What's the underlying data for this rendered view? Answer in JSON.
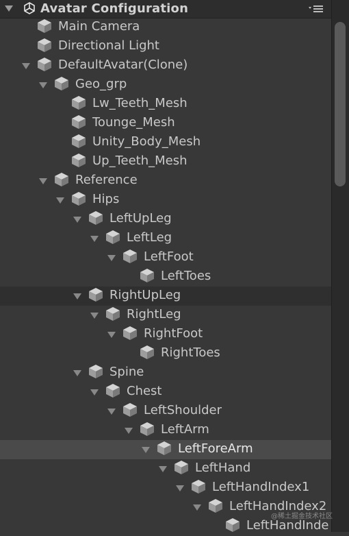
{
  "header": {
    "title": "Avatar Configuration",
    "logo_icon": "unity-logo-icon",
    "menu_icon": "dropdown-menu-icon"
  },
  "rows": [
    {
      "label": "Main Camera",
      "depth": 0,
      "expandable": false
    },
    {
      "label": "Directional Light",
      "depth": 0,
      "expandable": false
    },
    {
      "label": "DefaultAvatar(Clone)",
      "depth": 0,
      "expandable": true
    },
    {
      "label": "Geo_grp",
      "depth": 1,
      "expandable": true
    },
    {
      "label": "Lw_Teeth_Mesh",
      "depth": 2,
      "expandable": false
    },
    {
      "label": "Tounge_Mesh",
      "depth": 2,
      "expandable": false
    },
    {
      "label": "Unity_Body_Mesh",
      "depth": 2,
      "expandable": false
    },
    {
      "label": "Up_Teeth_Mesh",
      "depth": 2,
      "expandable": false
    },
    {
      "label": "Reference",
      "depth": 1,
      "expandable": true
    },
    {
      "label": "Hips",
      "depth": 2,
      "expandable": true
    },
    {
      "label": "LeftUpLeg",
      "depth": 3,
      "expandable": true
    },
    {
      "label": "LeftLeg",
      "depth": 4,
      "expandable": true
    },
    {
      "label": "LeftFoot",
      "depth": 5,
      "expandable": true
    },
    {
      "label": "LeftToes",
      "depth": 6,
      "expandable": false
    },
    {
      "label": "RightUpLeg",
      "depth": 3,
      "expandable": true,
      "state": "hover"
    },
    {
      "label": "RightLeg",
      "depth": 4,
      "expandable": true
    },
    {
      "label": "RightFoot",
      "depth": 5,
      "expandable": true
    },
    {
      "label": "RightToes",
      "depth": 6,
      "expandable": false
    },
    {
      "label": "Spine",
      "depth": 3,
      "expandable": true
    },
    {
      "label": "Chest",
      "depth": 4,
      "expandable": true
    },
    {
      "label": "LeftShoulder",
      "depth": 5,
      "expandable": true
    },
    {
      "label": "LeftArm",
      "depth": 6,
      "expandable": true
    },
    {
      "label": "LeftForeArm",
      "depth": 7,
      "expandable": true,
      "state": "selected"
    },
    {
      "label": "LeftHand",
      "depth": 8,
      "expandable": true
    },
    {
      "label": "LeftHandIndex1",
      "depth": 9,
      "expandable": true
    },
    {
      "label": "LeftHandIndex2",
      "depth": 10,
      "expandable": true
    },
    {
      "label": "LeftHandInde",
      "depth": 11,
      "expandable": false
    }
  ],
  "row_icon": "gameobject-cube-icon",
  "expand_icon": "expand-arrow-icon",
  "watermark": "@稀土掘金技术社区",
  "colors": {
    "background": "#383838",
    "selected_row": "#4a4a4a",
    "text": "#c9c9c9"
  }
}
